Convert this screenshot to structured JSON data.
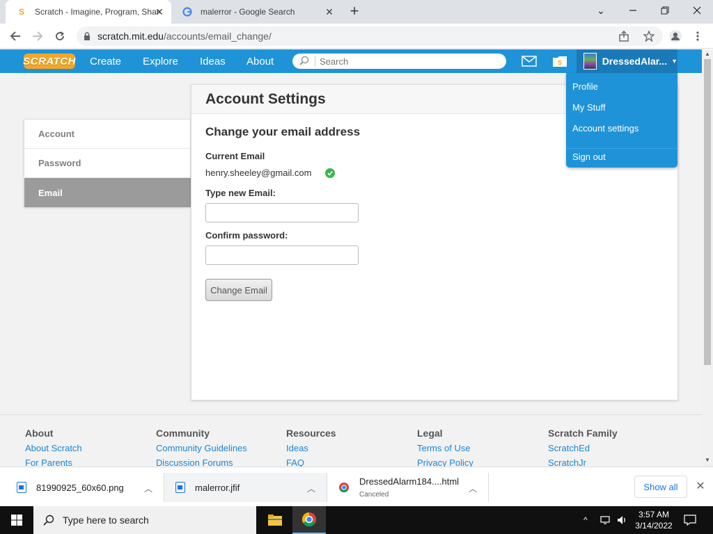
{
  "browser": {
    "tabs": [
      {
        "title": "Scratch - Imagine, Program, Share",
        "active": true
      },
      {
        "title": "malerror - Google Search",
        "active": false
      }
    ],
    "url_host": "scratch.mit.edu",
    "url_path": "/accounts/email_change/"
  },
  "header": {
    "logo": "SCRATCH",
    "nav": [
      "Create",
      "Explore",
      "Ideas",
      "About"
    ],
    "search_placeholder": "Search",
    "username": "DressedAlar..."
  },
  "user_menu": {
    "items": [
      "Profile",
      "My Stuff",
      "Account settings",
      "Sign out"
    ]
  },
  "sidebar": {
    "items": [
      "Account",
      "Password",
      "Email"
    ],
    "active_index": 2
  },
  "panel": {
    "title": "Account Settings",
    "subtitle": "Change your email address",
    "current_email_label": "Current Email",
    "current_email": "henry.sheeley@gmail.com",
    "new_email_label": "Type new Email:",
    "new_email_value": "",
    "password_label": "Confirm password:",
    "password_value": "",
    "submit_label": "Change Email"
  },
  "footer": {
    "columns": [
      {
        "heading": "About",
        "links": [
          "About Scratch",
          "For Parents"
        ]
      },
      {
        "heading": "Community",
        "links": [
          "Community Guidelines",
          "Discussion Forums"
        ]
      },
      {
        "heading": "Resources",
        "links": [
          "Ideas",
          "FAQ"
        ]
      },
      {
        "heading": "Legal",
        "links": [
          "Terms of Use",
          "Privacy Policy"
        ]
      },
      {
        "heading": "Scratch Family",
        "links": [
          "ScratchEd",
          "ScratchJr"
        ]
      }
    ]
  },
  "downloads": {
    "items": [
      {
        "name": "81990925_60x60.png",
        "status": ""
      },
      {
        "name": "malerror.jfif",
        "status": ""
      },
      {
        "name": "DressedAlarm184....html",
        "status": "Canceled"
      }
    ],
    "show_all": "Show all"
  },
  "taskbar": {
    "search_placeholder": "Type here to search",
    "time": "3:57 AM",
    "date": "3/14/2022"
  },
  "colors": {
    "scratch_blue": "#1f93d8",
    "link_blue": "#1a86d0",
    "success_green": "#3ab54a"
  }
}
